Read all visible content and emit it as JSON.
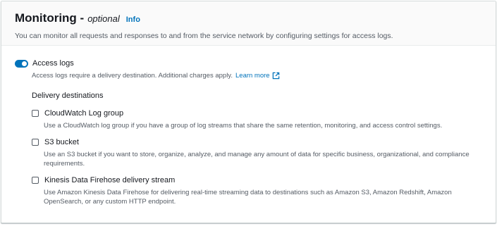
{
  "header": {
    "title": "Monitoring -",
    "optional": "optional",
    "info": "Info",
    "description": "You can monitor all requests and responses to and from the service network by configuring settings for access logs."
  },
  "access_logs": {
    "label": "Access logs",
    "enabled": true,
    "description": "Access logs require a delivery destination. Additional charges apply.",
    "learn_more": "Learn more"
  },
  "delivery": {
    "heading": "Delivery destinations",
    "options": [
      {
        "label": "CloudWatch Log group",
        "checked": false,
        "description": "Use a CloudWatch log group if you have a group of log streams that share the same retention, monitoring, and access control settings."
      },
      {
        "label": "S3 bucket",
        "checked": false,
        "description": "Use an S3 bucket if you want to store, organize, analyze, and manage any amount of data for specific business, organizational, and compliance requirements."
      },
      {
        "label": "Kinesis Data Firehose delivery stream",
        "checked": false,
        "description": "Use Amazon Kinesis Data Firehose for delivering real-time streaming data to destinations such as Amazon S3, Amazon Redshift, Amazon OpenSearch, or any custom HTTP endpoint."
      }
    ]
  },
  "colors": {
    "accent": "#0073bb",
    "text": "#16191f",
    "muted": "#545b64"
  }
}
